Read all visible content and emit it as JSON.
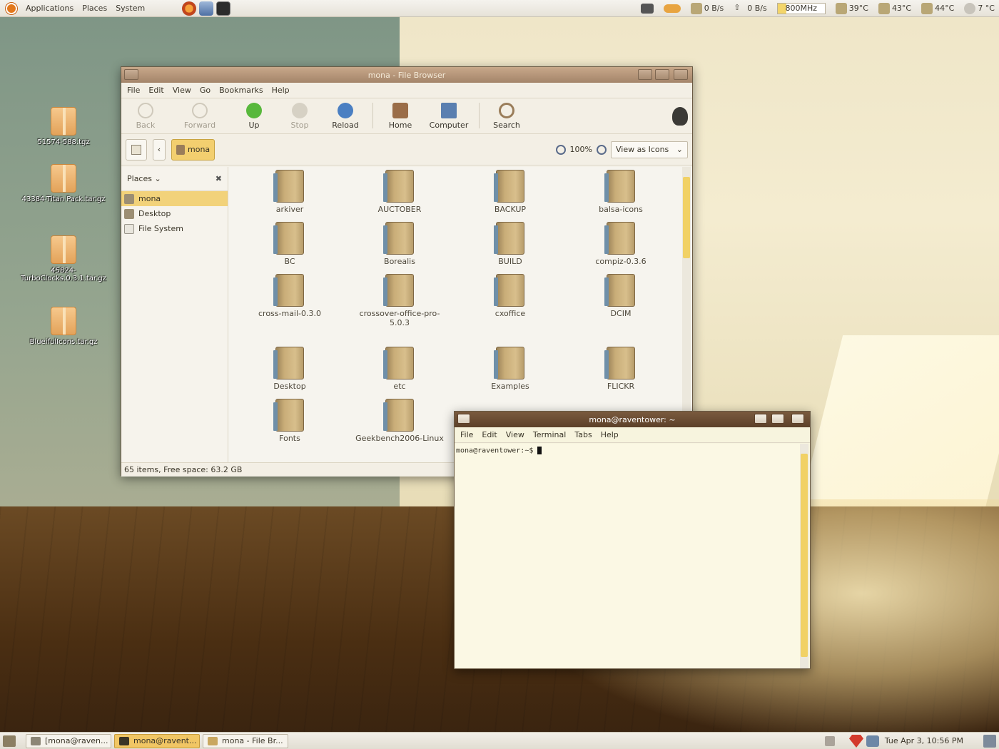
{
  "top_panel": {
    "menus": [
      "Applications",
      "Places",
      "System"
    ],
    "net_down": "0 B/s",
    "net_up": "0 B/s",
    "cpu_freq": "800MHz",
    "temp1": "39°C",
    "temp2": "43°C",
    "temp3": "44°C",
    "weather": "7 °C"
  },
  "desktop_icons": [
    {
      "label": "51574-588.tgz"
    },
    {
      "label": "43384-Titan Pack.tar.gz"
    },
    {
      "label": "45824-TurboClocks.0.3.1.tar.gz"
    },
    {
      "label": "BlueifulIcons.tar.gz"
    }
  ],
  "file_browser": {
    "title": "mona - File Browser",
    "menu": [
      "File",
      "Edit",
      "View",
      "Go",
      "Bookmarks",
      "Help"
    ],
    "toolbar": {
      "back": "Back",
      "forward": "Forward",
      "up": "Up",
      "stop": "Stop",
      "reload": "Reload",
      "home": "Home",
      "computer": "Computer",
      "search": "Search"
    },
    "location": "mona",
    "zoom": "100%",
    "view_mode": "View as Icons",
    "sidebar_title": "Places",
    "places": [
      "mona",
      "Desktop",
      "File System"
    ],
    "folders": [
      "arkiver",
      "AUCTOBER",
      "BACKUP",
      "balsa-icons",
      "BC",
      "Borealis",
      "BUILD",
      "compiz-0.3.6",
      "cross-mail-0.3.0",
      "crossover-office-pro-5.0.3",
      "cxoffice",
      "DCIM",
      "Desktop",
      "etc",
      "Examples",
      "FLICKR",
      "Fonts",
      "Geekbench2006-Linux"
    ],
    "status": "65 items, Free space: 63.2 GB"
  },
  "terminal": {
    "title": "mona@raventower: ~",
    "menu": [
      "File",
      "Edit",
      "View",
      "Terminal",
      "Tabs",
      "Help"
    ],
    "prompt": "mona@raventower:~$"
  },
  "taskbar": {
    "tasks": [
      "[mona@raven...",
      "mona@ravent...",
      "mona - File Br..."
    ],
    "clock": "Tue Apr  3, 10:56 PM"
  },
  "colors": {
    "accent": "#f1c664",
    "titlebar": "#a4856a",
    "terminal_titlebar": "#5c4029"
  }
}
